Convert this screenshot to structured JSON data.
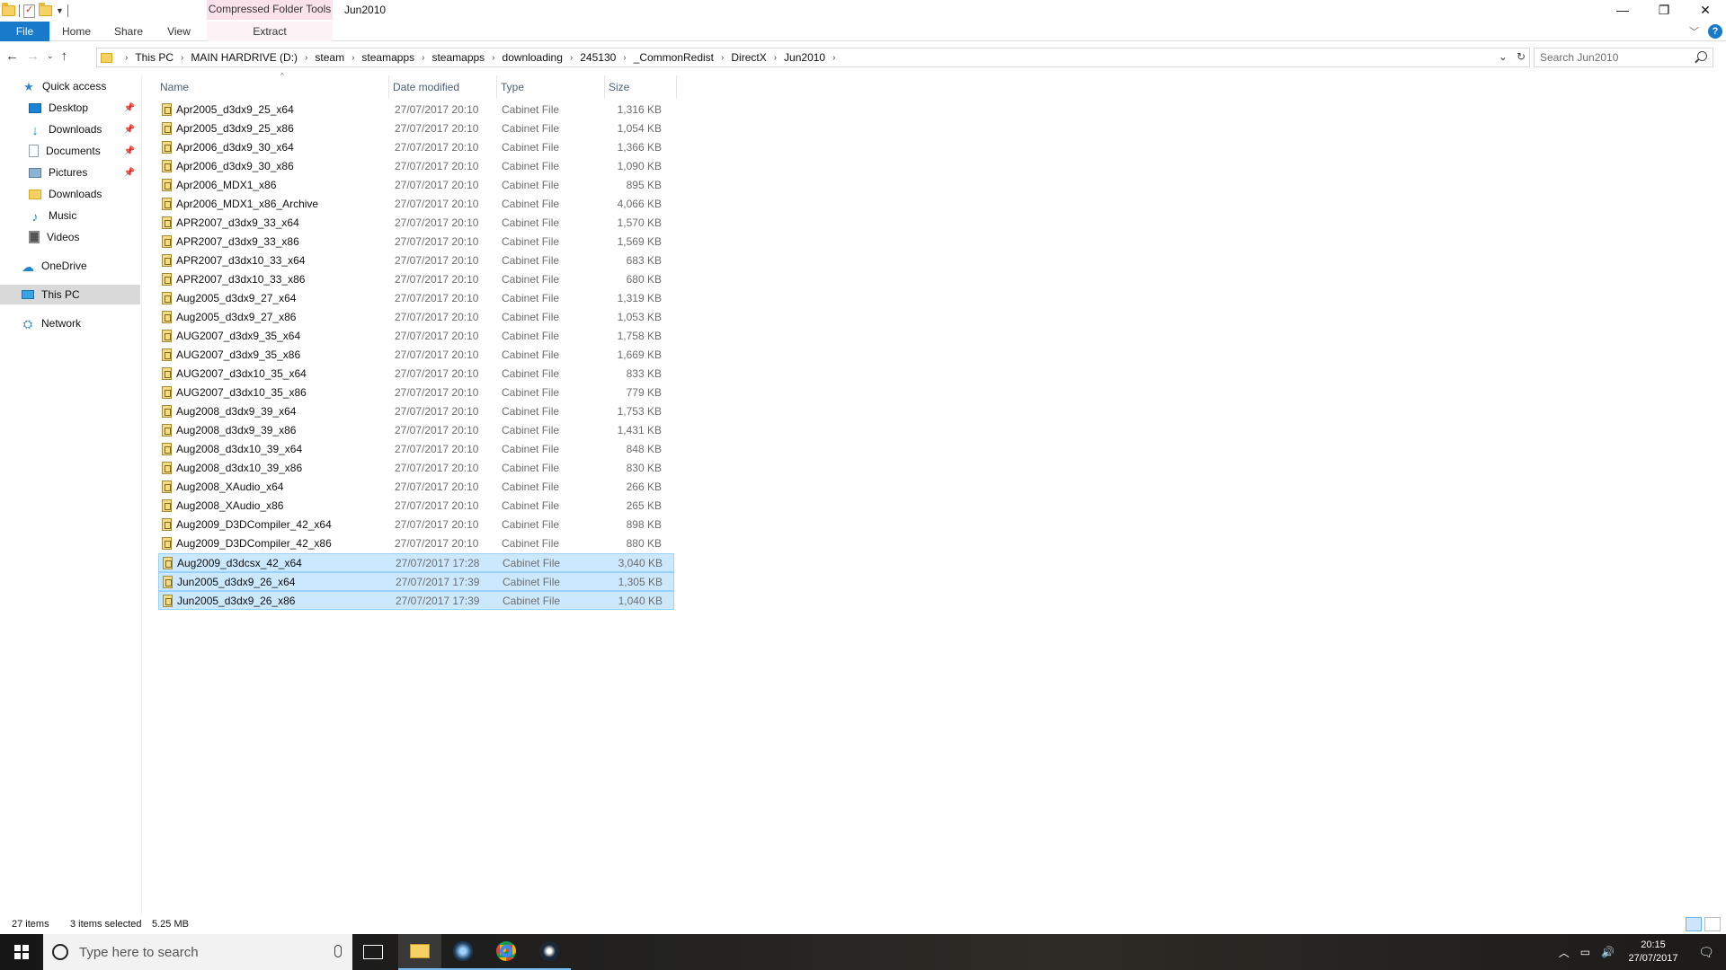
{
  "titlebar": {
    "context_tab_header": "Compressed Folder Tools",
    "window_title": "Jun2010",
    "controls": [
      "—",
      "❐",
      "✕"
    ]
  },
  "ribbon": {
    "tabs": [
      "File",
      "Home",
      "Share",
      "View"
    ],
    "extract_tab": "Extract",
    "accent_color": "#1979ca"
  },
  "address": {
    "crumbs": [
      "This PC",
      "MAIN HARDRIVE (D:)",
      "steam",
      "steamapps",
      "steamapps",
      "downloading",
      "245130",
      "_CommonRedist",
      "DirectX",
      "Jun2010"
    ],
    "search_placeholder": "Search Jun2010"
  },
  "nav": {
    "quick_access": "Quick access",
    "items": [
      {
        "label": "Desktop",
        "pinned": true
      },
      {
        "label": "Downloads",
        "pinned": true
      },
      {
        "label": "Documents",
        "pinned": true
      },
      {
        "label": "Pictures",
        "pinned": true
      },
      {
        "label": "Downloads",
        "pinned": false
      },
      {
        "label": "Music",
        "pinned": false
      },
      {
        "label": "Videos",
        "pinned": false
      }
    ],
    "onedrive": "OneDrive",
    "this_pc": "This PC",
    "network": "Network"
  },
  "columns": {
    "name": "Name",
    "date": "Date modified",
    "type": "Type",
    "size": "Size"
  },
  "files": [
    {
      "name": "Apr2005_d3dx9_25_x64",
      "date": "27/07/2017 20:10",
      "type": "Cabinet File",
      "size": "1,316 KB",
      "selected": false
    },
    {
      "name": "Apr2005_d3dx9_25_x86",
      "date": "27/07/2017 20:10",
      "type": "Cabinet File",
      "size": "1,054 KB",
      "selected": false
    },
    {
      "name": "Apr2006_d3dx9_30_x64",
      "date": "27/07/2017 20:10",
      "type": "Cabinet File",
      "size": "1,366 KB",
      "selected": false
    },
    {
      "name": "Apr2006_d3dx9_30_x86",
      "date": "27/07/2017 20:10",
      "type": "Cabinet File",
      "size": "1,090 KB",
      "selected": false
    },
    {
      "name": "Apr2006_MDX1_x86",
      "date": "27/07/2017 20:10",
      "type": "Cabinet File",
      "size": "895 KB",
      "selected": false
    },
    {
      "name": "Apr2006_MDX1_x86_Archive",
      "date": "27/07/2017 20:10",
      "type": "Cabinet File",
      "size": "4,066 KB",
      "selected": false
    },
    {
      "name": "APR2007_d3dx9_33_x64",
      "date": "27/07/2017 20:10",
      "type": "Cabinet File",
      "size": "1,570 KB",
      "selected": false
    },
    {
      "name": "APR2007_d3dx9_33_x86",
      "date": "27/07/2017 20:10",
      "type": "Cabinet File",
      "size": "1,569 KB",
      "selected": false
    },
    {
      "name": "APR2007_d3dx10_33_x64",
      "date": "27/07/2017 20:10",
      "type": "Cabinet File",
      "size": "683 KB",
      "selected": false
    },
    {
      "name": "APR2007_d3dx10_33_x86",
      "date": "27/07/2017 20:10",
      "type": "Cabinet File",
      "size": "680 KB",
      "selected": false
    },
    {
      "name": "Aug2005_d3dx9_27_x64",
      "date": "27/07/2017 20:10",
      "type": "Cabinet File",
      "size": "1,319 KB",
      "selected": false
    },
    {
      "name": "Aug2005_d3dx9_27_x86",
      "date": "27/07/2017 20:10",
      "type": "Cabinet File",
      "size": "1,053 KB",
      "selected": false
    },
    {
      "name": "AUG2007_d3dx9_35_x64",
      "date": "27/07/2017 20:10",
      "type": "Cabinet File",
      "size": "1,758 KB",
      "selected": false
    },
    {
      "name": "AUG2007_d3dx9_35_x86",
      "date": "27/07/2017 20:10",
      "type": "Cabinet File",
      "size": "1,669 KB",
      "selected": false
    },
    {
      "name": "AUG2007_d3dx10_35_x64",
      "date": "27/07/2017 20:10",
      "type": "Cabinet File",
      "size": "833 KB",
      "selected": false
    },
    {
      "name": "AUG2007_d3dx10_35_x86",
      "date": "27/07/2017 20:10",
      "type": "Cabinet File",
      "size": "779 KB",
      "selected": false
    },
    {
      "name": "Aug2008_d3dx9_39_x64",
      "date": "27/07/2017 20:10",
      "type": "Cabinet File",
      "size": "1,753 KB",
      "selected": false
    },
    {
      "name": "Aug2008_d3dx9_39_x86",
      "date": "27/07/2017 20:10",
      "type": "Cabinet File",
      "size": "1,431 KB",
      "selected": false
    },
    {
      "name": "Aug2008_d3dx10_39_x64",
      "date": "27/07/2017 20:10",
      "type": "Cabinet File",
      "size": "848 KB",
      "selected": false
    },
    {
      "name": "Aug2008_d3dx10_39_x86",
      "date": "27/07/2017 20:10",
      "type": "Cabinet File",
      "size": "830 KB",
      "selected": false
    },
    {
      "name": "Aug2008_XAudio_x64",
      "date": "27/07/2017 20:10",
      "type": "Cabinet File",
      "size": "266 KB",
      "selected": false
    },
    {
      "name": "Aug2008_XAudio_x86",
      "date": "27/07/2017 20:10",
      "type": "Cabinet File",
      "size": "265 KB",
      "selected": false
    },
    {
      "name": "Aug2009_D3DCompiler_42_x64",
      "date": "27/07/2017 20:10",
      "type": "Cabinet File",
      "size": "898 KB",
      "selected": false
    },
    {
      "name": "Aug2009_D3DCompiler_42_x86",
      "date": "27/07/2017 20:10",
      "type": "Cabinet File",
      "size": "880 KB",
      "selected": false
    },
    {
      "name": "Aug2009_d3dcsx_42_x64",
      "date": "27/07/2017 17:28",
      "type": "Cabinet File",
      "size": "3,040 KB",
      "selected": true
    },
    {
      "name": "Jun2005_d3dx9_26_x64",
      "date": "27/07/2017 17:39",
      "type": "Cabinet File",
      "size": "1,305 KB",
      "selected": true
    },
    {
      "name": "Jun2005_d3dx9_26_x86",
      "date": "27/07/2017 17:39",
      "type": "Cabinet File",
      "size": "1,040 KB",
      "selected": true
    }
  ],
  "status": {
    "count": "27 items",
    "selected": "3 items selected",
    "size": "5.25 MB"
  },
  "taskbar": {
    "search_placeholder": "Type here to search",
    "time": "20:15",
    "date": "27/07/2017"
  }
}
